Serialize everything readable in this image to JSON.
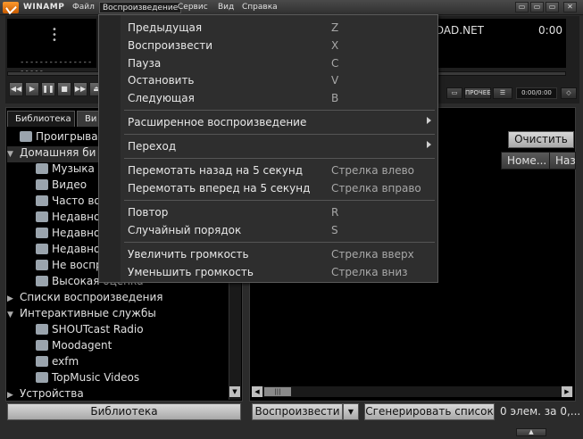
{
  "titlebar": {
    "app_name": "WINAMP",
    "menus": [
      "Файл",
      "Воспроизведение",
      "Сервис",
      "Вид",
      "Справка"
    ]
  },
  "window_controls": [
    "▭",
    "▭",
    "▭",
    "✕"
  ],
  "player": {
    "vis_dots": "•\n•\n•",
    "vis_dashes": "--------------------",
    "song_title": "DAD.NET",
    "time": "0:00",
    "buttons": [
      "◀◀",
      "▶",
      "❚❚",
      "■",
      "▶▶",
      "⏏"
    ],
    "small_buttons": [
      "▭",
      "ПРОЧЕЕ",
      "☰"
    ],
    "time_small": "0:00/0:00",
    "small_end_icon": "◇"
  },
  "library": {
    "tabs": [
      "Библиотека",
      "Ви"
    ],
    "tree": [
      {
        "arrow": "",
        "label": "Проигрывает",
        "icon": true,
        "indent": 0,
        "selected": false
      },
      {
        "arrow": "▼",
        "label": "Домашняя би",
        "icon": false,
        "indent": 0,
        "selected": true
      },
      {
        "arrow": "",
        "label": "Музыка",
        "icon": true,
        "indent": 1,
        "selected": false
      },
      {
        "arrow": "",
        "label": "Видео",
        "icon": true,
        "indent": 1,
        "selected": false
      },
      {
        "arrow": "",
        "label": "Часто восп",
        "icon": true,
        "indent": 1,
        "selected": false
      },
      {
        "arrow": "",
        "label": "Недавно д",
        "icon": true,
        "indent": 1,
        "selected": false
      },
      {
        "arrow": "",
        "label": "Недавно и",
        "icon": true,
        "indent": 1,
        "selected": false
      },
      {
        "arrow": "",
        "label": "Недавно в",
        "icon": true,
        "indent": 1,
        "selected": false
      },
      {
        "arrow": "",
        "label": "Не воспро",
        "icon": true,
        "indent": 1,
        "selected": false
      },
      {
        "arrow": "",
        "label": "Высокая оценка",
        "icon": true,
        "indent": 1,
        "selected": false
      },
      {
        "arrow": "▶",
        "label": "Списки воспроизведения",
        "icon": false,
        "indent": 0,
        "selected": false
      },
      {
        "arrow": "▼",
        "label": "Интерактивные службы",
        "icon": false,
        "indent": 0,
        "selected": false
      },
      {
        "arrow": "",
        "label": "SHOUTcast Radio",
        "icon": true,
        "indent": 1,
        "selected": false
      },
      {
        "arrow": "",
        "label": "Moodagent",
        "icon": true,
        "indent": 1,
        "selected": false
      },
      {
        "arrow": "",
        "label": "exfm",
        "icon": true,
        "indent": 1,
        "selected": false
      },
      {
        "arrow": "",
        "label": "TopMusic Videos",
        "icon": true,
        "indent": 1,
        "selected": false
      },
      {
        "arrow": "▶",
        "label": "Устройства",
        "icon": false,
        "indent": 0,
        "selected": false
      }
    ],
    "scroll_down": "▼"
  },
  "right_pane": {
    "clear_button": "Очистить",
    "columns": [
      "Номе...",
      "Наз"
    ],
    "scroll_left": "◀",
    "scroll_thumb": "|||",
    "scroll_right": "▶"
  },
  "bottom": {
    "library_button": "Библиотека",
    "play_button": "Воспроизвести",
    "play_dropdown": "▼",
    "generate_button": "Сгенерировать список",
    "status": "0 элем. за 0,...",
    "grip": "▲"
  },
  "dropdown": {
    "items": [
      {
        "label": "Предыдущая",
        "shortcut": "Z",
        "submenu": false
      },
      {
        "label": "Воспроизвести",
        "shortcut": "X",
        "submenu": false
      },
      {
        "label": "Пауза",
        "shortcut": "C",
        "submenu": false
      },
      {
        "label": "Остановить",
        "shortcut": "V",
        "submenu": false
      },
      {
        "label": "Следующая",
        "shortcut": "B",
        "submenu": false
      },
      {
        "label": "Расширенное воспроизведение",
        "shortcut": "",
        "submenu": true
      },
      {
        "label": "Переход",
        "shortcut": "",
        "submenu": true
      },
      {
        "label": "Перемотать назад на 5 секунд",
        "shortcut": "Стрелка влево",
        "submenu": false
      },
      {
        "label": "Перемотать вперед на 5 секунд",
        "shortcut": "Стрелка вправо",
        "submenu": false
      },
      {
        "label": "Повтор",
        "shortcut": "R",
        "submenu": false
      },
      {
        "label": "Случайный порядок",
        "shortcut": "S",
        "submenu": false
      },
      {
        "label": "Увеличить громкость",
        "shortcut": "Стрелка вверх",
        "submenu": false
      },
      {
        "label": "Уменьшить громкость",
        "shortcut": "Стрелка вниз",
        "submenu": false
      }
    ]
  }
}
